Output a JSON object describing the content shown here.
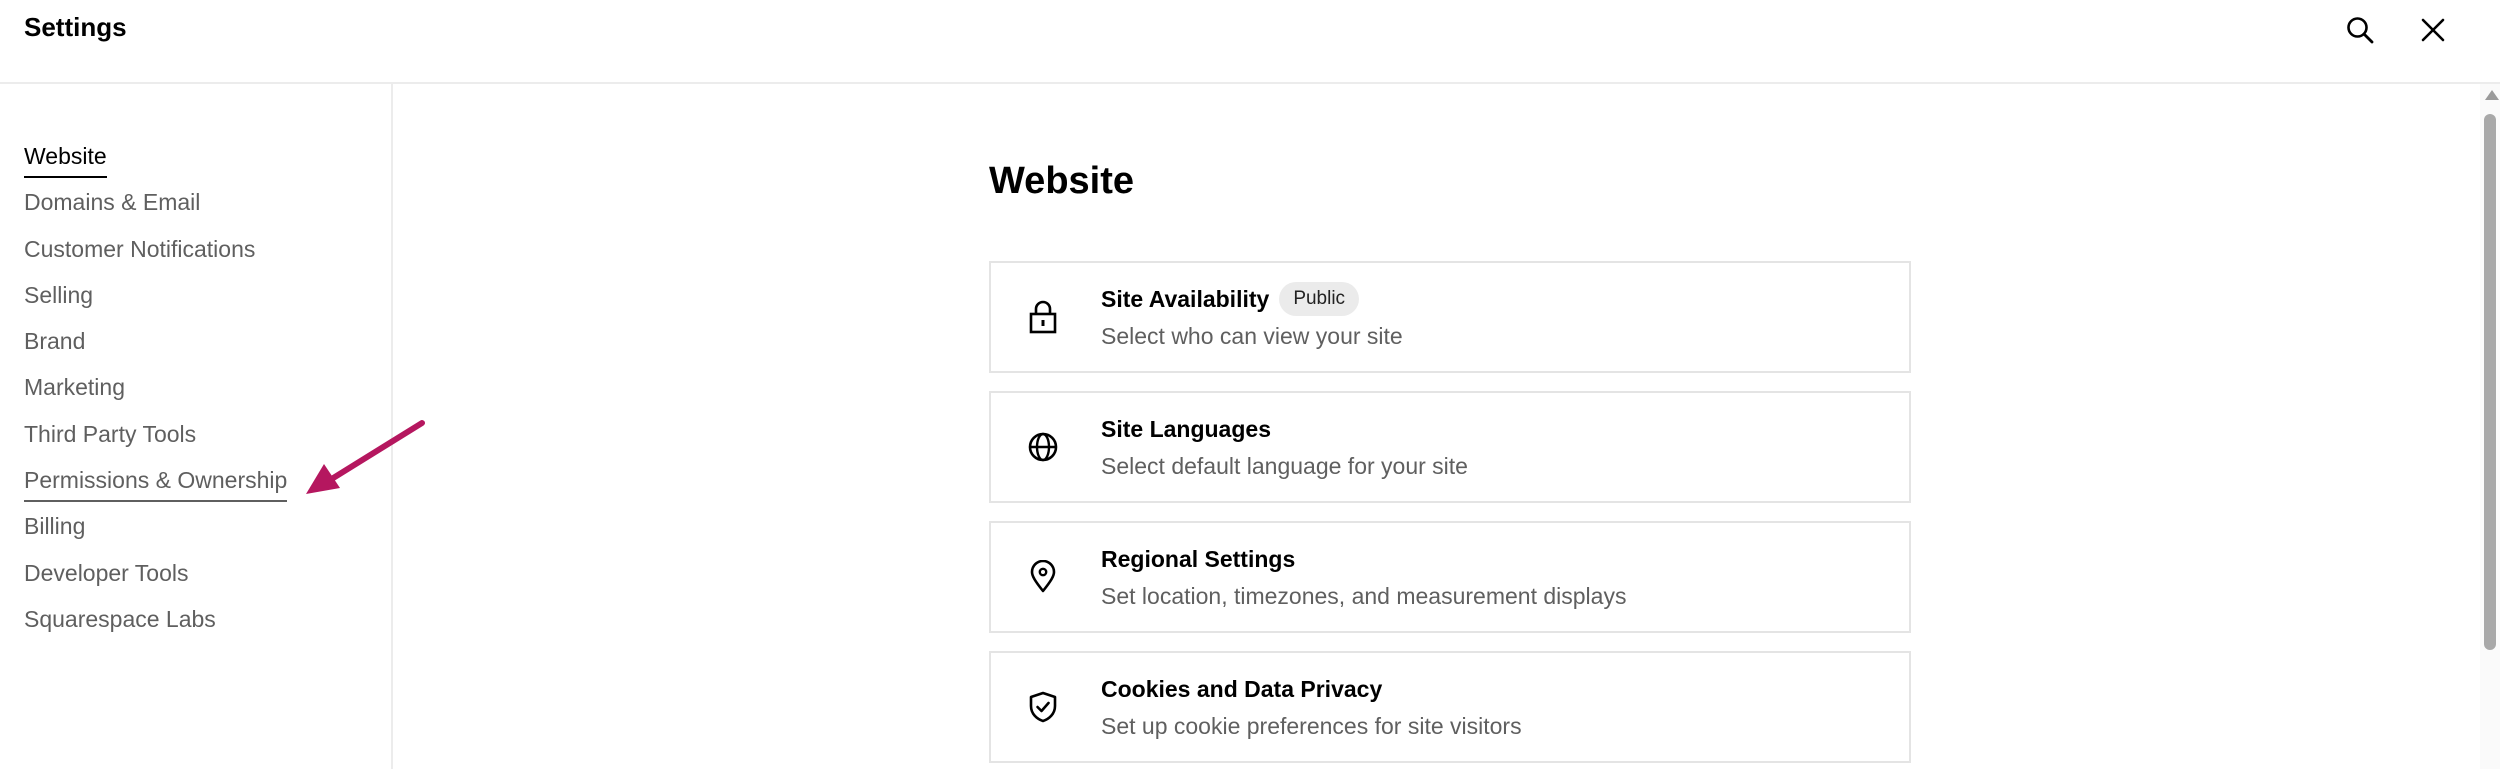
{
  "header": {
    "title": "Settings",
    "search_icon": "search-icon",
    "close_icon": "close-icon"
  },
  "sidebar": {
    "items": [
      {
        "label": "Website",
        "state": "active"
      },
      {
        "label": "Domains & Email"
      },
      {
        "label": "Customer Notifications"
      },
      {
        "label": "Selling"
      },
      {
        "label": "Brand"
      },
      {
        "label": "Marketing"
      },
      {
        "label": "Third Party Tools"
      },
      {
        "label": "Permissions & Ownership",
        "state": "hover"
      },
      {
        "label": "Billing"
      },
      {
        "label": "Developer Tools"
      },
      {
        "label": "Squarespace Labs"
      }
    ]
  },
  "annotation": {
    "color": "#b5175f",
    "points_to": "Permissions & Ownership"
  },
  "main": {
    "title": "Website",
    "cards": [
      {
        "icon": "lock-icon",
        "title": "Site Availability",
        "badge": "Public",
        "subtitle": "Select who can view your site"
      },
      {
        "icon": "globe-icon",
        "title": "Site Languages",
        "subtitle": "Select default language for your site"
      },
      {
        "icon": "location-pin-icon",
        "title": "Regional Settings",
        "subtitle": "Set location, timezones, and measurement displays"
      },
      {
        "icon": "shield-check-icon",
        "title": "Cookies and Data Privacy",
        "subtitle": "Set up cookie preferences for site visitors"
      }
    ]
  },
  "colors": {
    "text_primary": "#000000",
    "text_secondary": "#5f5f5f",
    "border": "#e4e4e4",
    "badge_bg": "#ebebeb"
  }
}
